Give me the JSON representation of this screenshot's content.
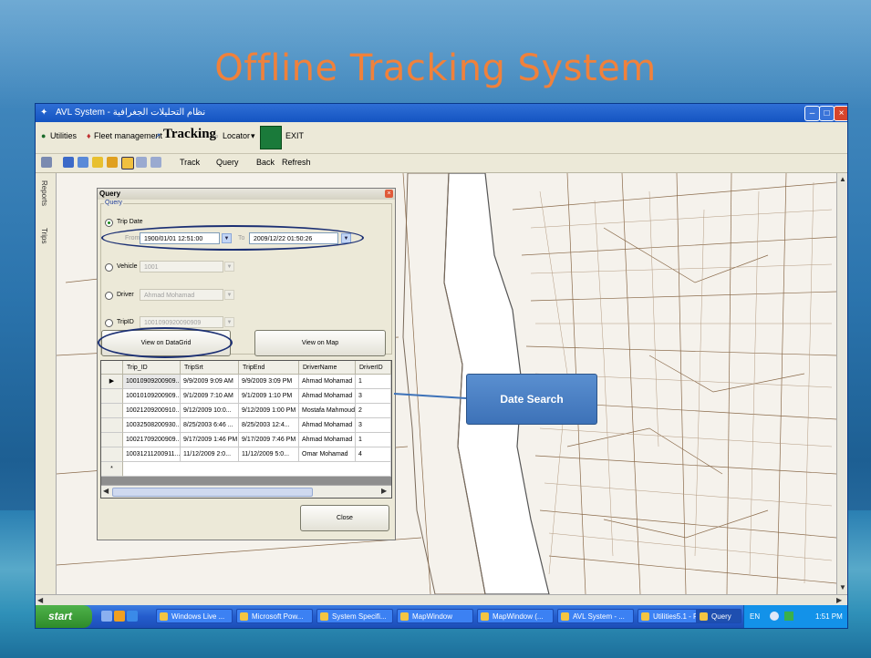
{
  "slide": {
    "title": "Offline Tracking System"
  },
  "window": {
    "title": "AVL System - نظام التحليلات الجغرافية",
    "menu": {
      "utilities": "Utilities",
      "fleet": "Fleet management",
      "tracking": "Tracking",
      "locator": "Locator",
      "exit": "EXIT"
    },
    "toolbar": {
      "track": "Track",
      "query": "Query",
      "back": "Back",
      "refresh": "Refresh"
    },
    "sidebar_tabs": [
      "Reports",
      "Trips"
    ]
  },
  "query_dialog": {
    "title": "Query",
    "group_label": "Query",
    "trip_date_label": "Trip Date",
    "from_label": "From",
    "from_value": "1900/01/01  12:51:00",
    "to_label": "To",
    "to_value": "2009/12/22  01:50:26",
    "vehicle_label": "Vehicle",
    "vehicle_value": "1001",
    "driver_label": "Driver",
    "driver_value": "Ahmad Mohamad",
    "tripid_label": "TripID",
    "tripid_value": "1001090920090909",
    "btn_grid": "View on DataGrid",
    "btn_map": "View on Map",
    "btn_close": "Close",
    "grid": {
      "columns": [
        "Trip_ID",
        "TripSrt",
        "TripEnd",
        "DriverName",
        "DriverID"
      ],
      "rows": [
        [
          "10010909200909...",
          "9/9/2009 9:09 AM",
          "9/9/2009 3:09 PM",
          "Ahmad Mohamad",
          "1"
        ],
        [
          "10010109200909...",
          "9/1/2009 7:10 AM",
          "9/1/2009 1:10 PM",
          "Ahmad Mohamad",
          "3"
        ],
        [
          "10021209200910...",
          "9/12/2009 10:0...",
          "9/12/2009 1:00 PM",
          "Mostafa Mahmoud",
          "2"
        ],
        [
          "10032508200930...",
          "8/25/2003 6:46 ...",
          "8/25/2003 12:4...",
          "Ahmad Mohamad",
          "3"
        ],
        [
          "10021709200909...",
          "9/17/2009 1:46 PM",
          "9/17/2009 7:46 PM",
          "Ahmad Mohamad",
          "1"
        ],
        [
          "10031211200911...",
          "11/12/2009 2:0...",
          "11/12/2009 5:0...",
          "Omar Mohamad",
          "4"
        ]
      ],
      "new_row_marker": "*"
    }
  },
  "callout": {
    "text": "Date Search"
  },
  "taskbar": {
    "start": "start",
    "tasks": [
      "Windows Live ...",
      "Microsoft Pow...",
      "System Specifi...",
      "MapWindow",
      "MapWindow (...",
      "AVL System - ...",
      "Utilities5.1 - P...",
      "Query"
    ],
    "lang": "EN",
    "clock": "1:51 PM"
  },
  "colors": {
    "title": "#f0813b",
    "callout": "#4a7fc4",
    "xp_blue": "#245ccd"
  }
}
